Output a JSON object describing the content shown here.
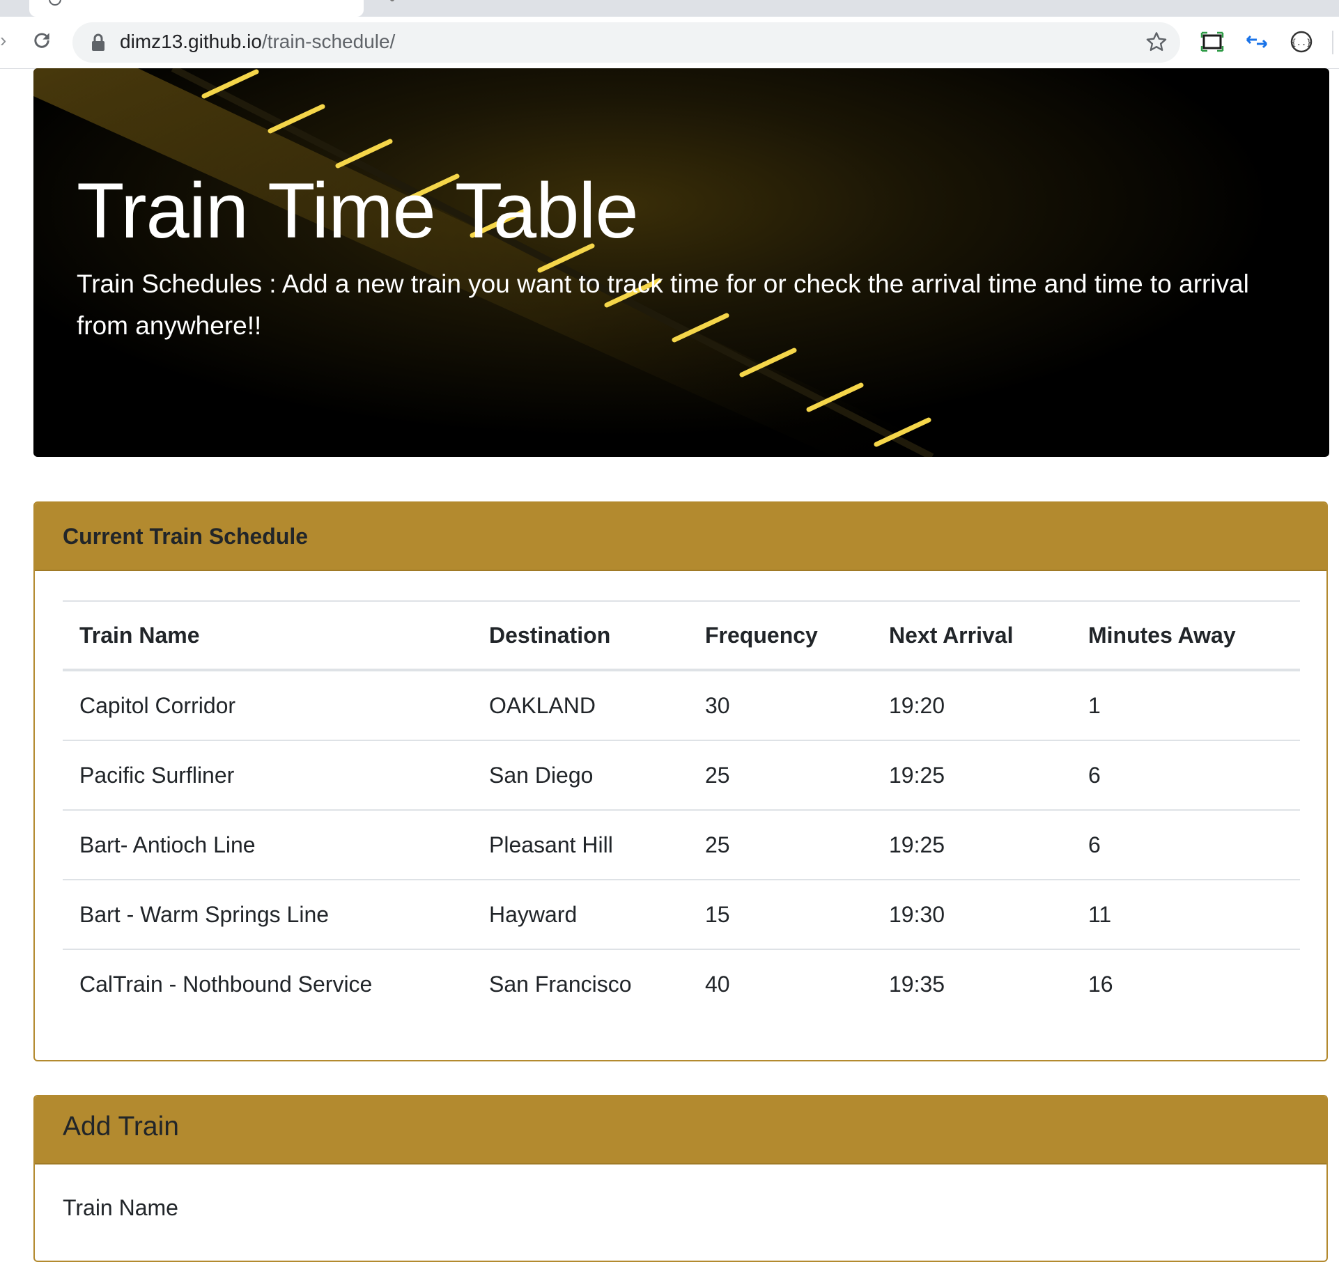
{
  "browser": {
    "url_host": "dimz13.github.io",
    "url_path": "/train-schedule/"
  },
  "hero": {
    "title": "Train Time Table",
    "lead": "Train Schedules : Add a new train you want to track time for or check the arrival time and time to arrival from anywhere!!"
  },
  "schedule": {
    "title": "Current Train Schedule",
    "columns": [
      "Train Name",
      "Destination",
      "Frequency",
      "Next Arrival",
      "Minutes Away"
    ],
    "rows": [
      [
        "Capitol Corridor",
        "OAKLAND",
        "30",
        "19:20",
        "1"
      ],
      [
        "Pacific Surfliner",
        "San Diego",
        "25",
        "19:25",
        "6"
      ],
      [
        "Bart- Antioch Line",
        "Pleasant Hill",
        "25",
        "19:25",
        "6"
      ],
      [
        "Bart - Warm Springs Line",
        "Hayward",
        "15",
        "19:30",
        "11"
      ],
      [
        "CalTrain - Nothbound Service",
        "San Francisco",
        "40",
        "19:35",
        "16"
      ]
    ]
  },
  "add_train": {
    "title": "Add Train",
    "train_name_label": "Train Name"
  },
  "colors": {
    "card_accent": "#b38a2f",
    "hero_background": "#000000",
    "rail_highlight": "#f5d64a"
  },
  "icons": {
    "reload": "reload-icon",
    "lock": "lock-icon",
    "bookmark": "star-icon",
    "screen_capture": "screen-capture-icon",
    "swap": "swap-arrows-icon",
    "json_viewer": "json-icon"
  }
}
